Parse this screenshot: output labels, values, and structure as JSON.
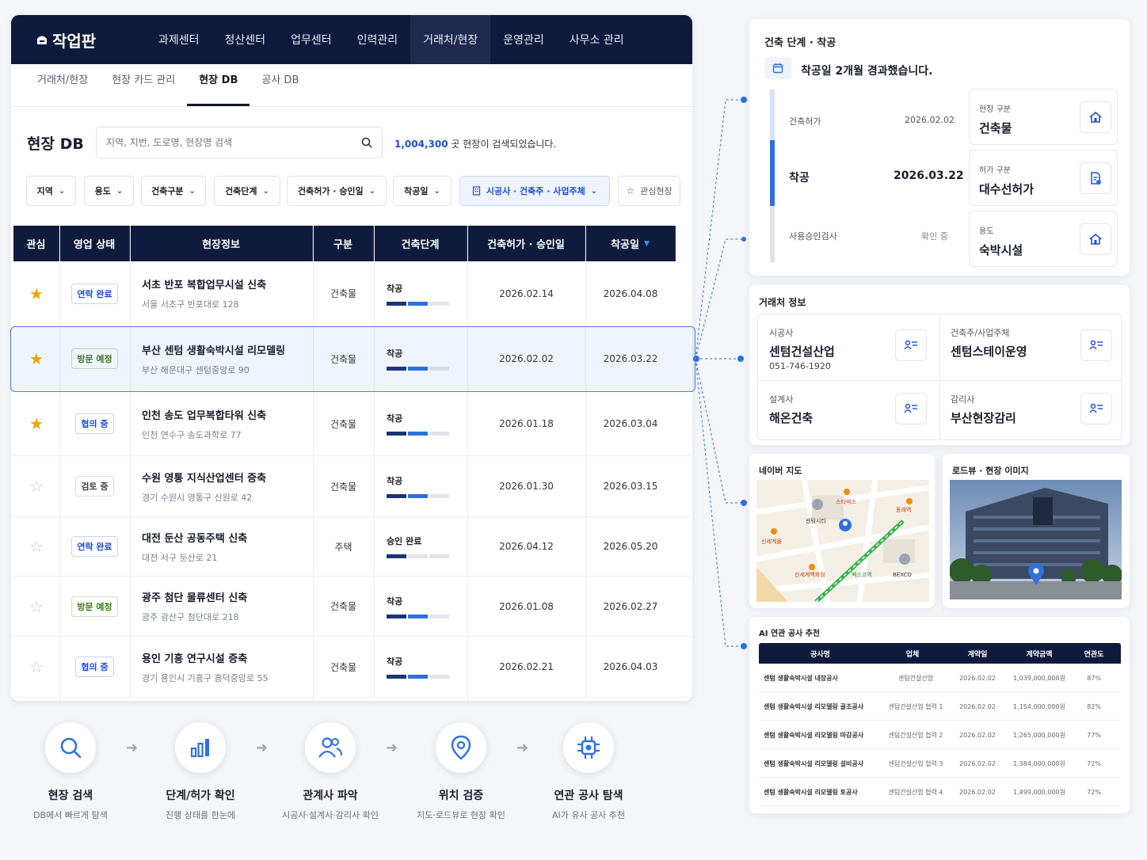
{
  "app": {
    "logo": "작업판"
  },
  "nav": [
    "과제센터",
    "정산센터",
    "업무센터",
    "인력관리",
    "거래처/현장",
    "운영관리",
    "사무소 관리"
  ],
  "subtabs": [
    "거래처/현장",
    "현장 카드 관리",
    "현장 DB",
    "공사 DB"
  ],
  "page": {
    "title": "현장 DB",
    "search_placeholder": "지역, 지번, 도로명, 현장명 검색",
    "result_count": "1,004,300",
    "result_suffix": "곳 현장이 검색되었습니다."
  },
  "filters": [
    "지역",
    "용도",
    "건축구분",
    "건축단계",
    "건축허가 · 승인일",
    "착공일",
    "시공사 · 건축주 · 사업주체",
    "관심현장"
  ],
  "table": {
    "headers": [
      "관심",
      "영업 상태",
      "현장정보",
      "구분",
      "건축단계",
      "건축허가 · 승인일",
      "착공일"
    ],
    "rows": [
      {
        "starred": true,
        "status": "연락 완료",
        "name": "서초 반포 복합업무시설 신축",
        "addr": "서울 서초구 반포대로 128",
        "type": "건축물",
        "stage": "착공",
        "progress": 0.66,
        "permit": "2026.02.14",
        "start": "2026.04.08"
      },
      {
        "starred": true,
        "status": "방문 예정",
        "name": "부산 센텀 생활숙박시설 리모델링",
        "addr": "부산 해운대구 센텀중앙로 90",
        "type": "건축물",
        "stage": "착공",
        "progress": 0.66,
        "permit": "2026.02.02",
        "start": "2026.03.22"
      },
      {
        "starred": true,
        "status": "협의 중",
        "name": "인천 송도 업무복합타워 신축",
        "addr": "인천 연수구 송도과학로 77",
        "type": "건축물",
        "stage": "착공",
        "progress": 0.66,
        "permit": "2026.01.18",
        "start": "2026.03.04"
      },
      {
        "starred": false,
        "status": "검토 중",
        "name": "수원 영통 지식산업센터 증축",
        "addr": "경기 수원시 영통구 신원로 42",
        "type": "건축물",
        "stage": "착공",
        "progress": 0.66,
        "permit": "2026.01.30",
        "start": "2026.03.15"
      },
      {
        "starred": false,
        "status": "연락 완료",
        "name": "대전 둔산 공동주택 신축",
        "addr": "대전 서구 둔산로 21",
        "type": "주택",
        "stage": "승인 완료",
        "progress": 0.33,
        "permit": "2026.04.12",
        "start": "2026.05.20"
      },
      {
        "starred": false,
        "status": "방문 예정",
        "name": "광주 첨단 물류센터 신축",
        "addr": "광주 광산구 첨단대로 218",
        "type": "건축물",
        "stage": "착공",
        "progress": 0.66,
        "permit": "2026.01.08",
        "start": "2026.02.27"
      },
      {
        "starred": false,
        "status": "협의 중",
        "name": "용인 기흥 연구시설 증축",
        "addr": "경기 용인시 기흥구 흥덕중앙로 55",
        "type": "건축물",
        "stage": "착공",
        "progress": 0.66,
        "permit": "2026.02.21",
        "start": "2026.04.03"
      }
    ]
  },
  "stage_panel": {
    "title": "건축 단계 · 착공",
    "notice": "착공일 2개월 경과했습니다.",
    "timeline": [
      {
        "label": "건축허가",
        "value": "2026.02.02"
      },
      {
        "label": "착공",
        "value": "2026.03.22"
      },
      {
        "label": "사용승인검사",
        "value": "확인 중"
      }
    ],
    "info": [
      {
        "label": "현장 구분",
        "value": "건축물"
      },
      {
        "label": "허가 구분",
        "value": "대수선허가"
      },
      {
        "label": "용도",
        "value": "숙박시설"
      }
    ]
  },
  "partner_panel": {
    "title": "거래처 정보",
    "items": [
      {
        "label": "시공사",
        "value": "센텀건설산업",
        "phone": "051-746-1920"
      },
      {
        "label": "건축주/사업주체",
        "value": "센텀스테이운영"
      },
      {
        "label": "설계사",
        "value": "해온건축"
      },
      {
        "label": "감리사",
        "value": "부산현장감리"
      }
    ]
  },
  "map_panel": {
    "title": "네이버 지도",
    "labels": [
      "센텀시티",
      "신세계몰",
      "신세계백화점",
      "BEXCO",
      "스타벅스",
      "동래역",
      "벡스코역"
    ]
  },
  "road_panel": {
    "title": "로드뷰 · 현장 이미지"
  },
  "ai_panel": {
    "title": "AI 연관 공사 추천",
    "headers": [
      "공사명",
      "업체",
      "계약일",
      "계약금액",
      "연관도"
    ],
    "rows": [
      [
        "센텀 생활숙박시설 내장공사",
        "센텀건설산업",
        "2026.02.02",
        "1,039,000,000원",
        "87%"
      ],
      [
        "센텀 생활숙박시설 리모델링 골조공사",
        "센텀건설산업 협력 1",
        "2026.02.02",
        "1,154,000,000원",
        "82%"
      ],
      [
        "센텀 생활숙박시설 리모델링 마감공사",
        "센텀건설산업 협력 2",
        "2026.02.02",
        "1,265,000,000원",
        "77%"
      ],
      [
        "센텀 생활숙박시설 리모델링 설비공사",
        "센텀건설산업 협력 3",
        "2026.02.02",
        "1,384,000,000원",
        "72%"
      ],
      [
        "센텀 생활숙박시설 리모델링 토공사",
        "센텀건설산업 협력 4",
        "2026.02.02",
        "1,499,000,000원",
        "72%"
      ]
    ]
  },
  "steps": [
    {
      "title": "현장 검색",
      "desc": "DB에서 빠르게 탐색",
      "icon": "search-icon"
    },
    {
      "title": "단계/허가 확인",
      "desc": "진행 상태를 한눈에",
      "icon": "bar-chart-icon"
    },
    {
      "title": "관계사 파악",
      "desc": "시공사·설계사·감리사 확인",
      "icon": "users-icon"
    },
    {
      "title": "위치 검증",
      "desc": "지도·로드뷰로 현장 확인",
      "icon": "location-pin-icon"
    },
    {
      "title": "연관 공사 탐색",
      "desc": "AI가 유사 공사 추천",
      "icon": "ai-chip-icon"
    }
  ],
  "colors": {
    "navy": "#0e1b3c",
    "accent": "#2f6fe0",
    "star": "#f5a50b"
  }
}
